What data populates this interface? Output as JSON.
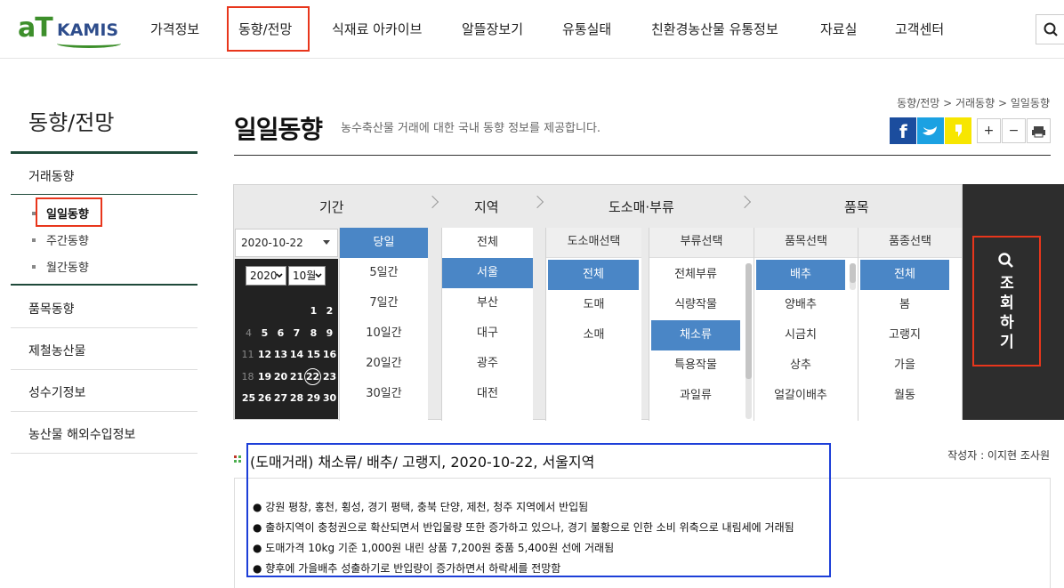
{
  "header": {
    "logo_at": "aT",
    "logo_kamis": "KAMIS",
    "nav": [
      "가격정보",
      "동향/전망",
      "식재료 아카이브",
      "알뜰장보기",
      "유통실태",
      "친환경농산물 유통정보",
      "자료실",
      "고객센터"
    ],
    "active_nav": "동향/전망"
  },
  "sidebar": {
    "title": "동향/전망",
    "section": "거래동향",
    "sub": [
      "일일동향",
      "주간동향",
      "월간동향"
    ],
    "items": [
      "품목동향",
      "제철농산물",
      "성수기정보",
      "농산물 해외수입정보"
    ]
  },
  "page": {
    "title": "일일동향",
    "desc": "농수축산물 거래에 대한 국내 동향 정보를 제공합니다.",
    "breadcrumb": "동향/전망 > 거래동향 > 일일동향"
  },
  "tools": {
    "plus": "+",
    "minus": "−"
  },
  "filter": {
    "headers": {
      "period": "기간",
      "region": "지역",
      "trade": "도소매·부류",
      "item": "품목"
    },
    "date": "2020-10-22",
    "cal_year": "2020",
    "cal_month": "10월",
    "cal_rows": [
      [
        "",
        "",
        "",
        "",
        "",
        "1",
        "2"
      ],
      [
        "4",
        "5",
        "6",
        "7",
        "8",
        "9"
      ],
      [
        "11",
        "12",
        "13",
        "14",
        "15",
        "16"
      ],
      [
        "18",
        "19",
        "20",
        "21",
        "22",
        "23"
      ],
      [
        "25",
        "26",
        "27",
        "28",
        "29",
        "30"
      ]
    ],
    "periods": [
      "당일",
      "5일간",
      "7일간",
      "10일간",
      "20일간",
      "30일간"
    ],
    "regions": [
      "전체",
      "서울",
      "부산",
      "대구",
      "광주",
      "대전"
    ],
    "trade_head": "도소매선택",
    "trade": [
      "전체",
      "도매",
      "소매"
    ],
    "class_head": "부류선택",
    "classes": [
      "전체부류",
      "식량작물",
      "채소류",
      "특용작물",
      "과일류"
    ],
    "item_head": "품목선택",
    "items": [
      "배추",
      "양배추",
      "시금치",
      "상추",
      "얼갈이배추"
    ],
    "variety_head": "품종선택",
    "varieties": [
      "전체",
      "봄",
      "고랭지",
      "가을",
      "월동"
    ],
    "search_label": "조회하기"
  },
  "report": {
    "title": "(도매거래) 채소류/ 배추/ 고랭지, 2020-10-22, 서울지역",
    "author": "작성자 : 이지현 조사원",
    "lines": [
      "● 강원 평창, 홍천, 횡성, 경기 평택, 충북 단양, 제천, 청주 지역에서 반입됨",
      "● 출하지역이 충청권으로 확산되면서 반입물량 또한 증가하고 있으나, 경기 불황으로 인한 소비 위축으로 내림세에 거래됨",
      "● 도매가격 10kg 기준 1,000원 내린 상품 7,200원 중품 5,400원 선에 거래됨",
      "● 향후에 가을배추 성출하기로 반입량이 증가하면서 하락세를 전망함"
    ]
  },
  "colors": {
    "selected": "#4a86c6",
    "highlight_red": "#e8361c",
    "highlight_blue": "#1d3fd8",
    "dark": "#2d2d2d"
  }
}
